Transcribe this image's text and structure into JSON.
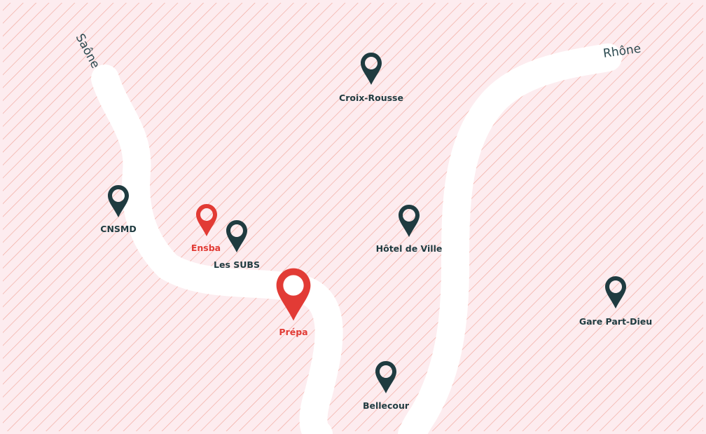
{
  "map": {
    "colors": {
      "hatch": "#f2a79c",
      "background": "#fdecef",
      "river": "#ffffff",
      "marker_dark": "#1f3b40",
      "marker_accent": "#e23b35"
    },
    "rivers": [
      {
        "name": "Saône"
      },
      {
        "name": "Rhône"
      }
    ],
    "locations": {
      "croix_rousse": {
        "label": "Croix-Rousse",
        "style": "dark"
      },
      "cnsmd": {
        "label": "CNSMD",
        "style": "dark"
      },
      "ensba": {
        "label": "Ensba",
        "style": "accent"
      },
      "les_subs": {
        "label": "Les SUBS",
        "style": "dark"
      },
      "hotel_de_ville": {
        "label": "Hôtel de Ville",
        "style": "dark"
      },
      "prepa": {
        "label": "Prépa",
        "style": "accent-large"
      },
      "gare_part_dieu": {
        "label": "Gare Part-Dieu",
        "style": "dark"
      },
      "bellecour": {
        "label": "Bellecour",
        "style": "dark"
      }
    }
  }
}
